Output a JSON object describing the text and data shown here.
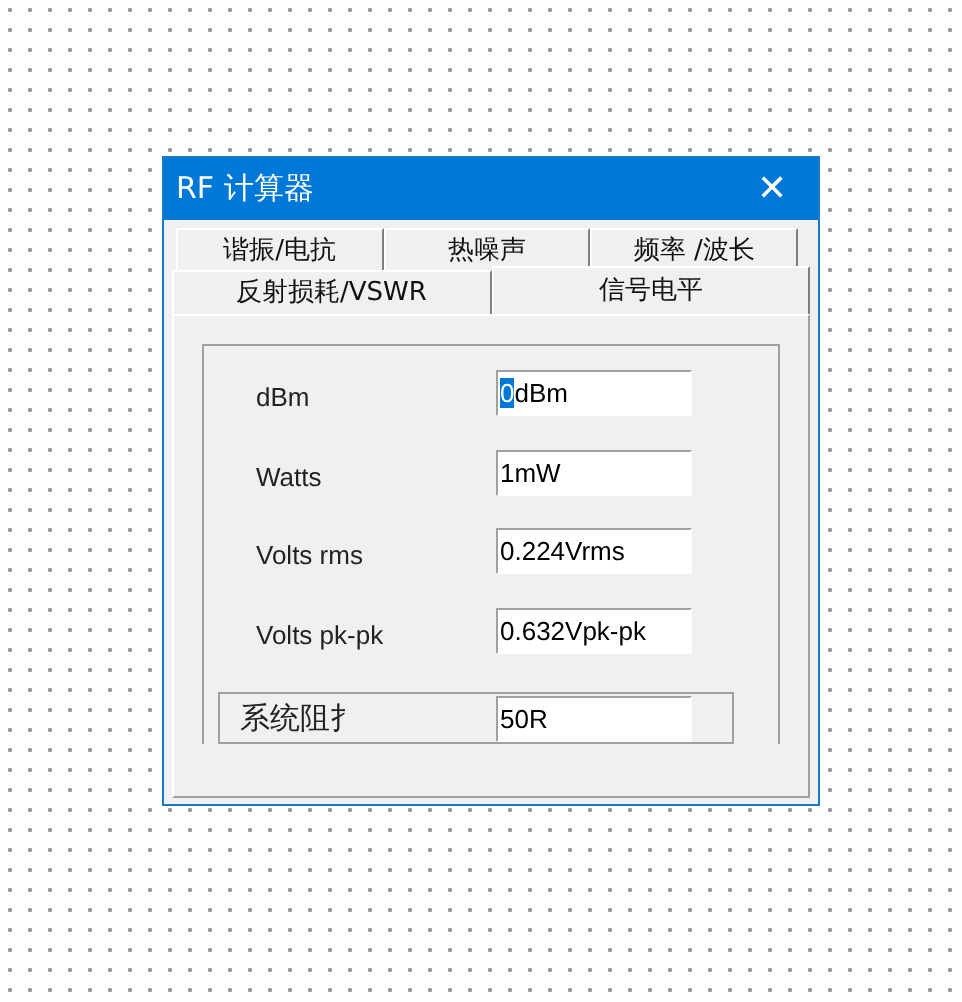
{
  "window": {
    "title": "RF 计算器",
    "close": "✕"
  },
  "tab_rows": [
    [
      {
        "label": "谐振/电抗",
        "selected": false
      },
      {
        "label": "热噪声",
        "selected": false
      },
      {
        "label": "频率 /波长",
        "selected": false
      }
    ],
    [
      {
        "label": "反射损耗/VSWR",
        "selected": false
      },
      {
        "label": "信号电平",
        "selected": true
      }
    ]
  ],
  "fields": [
    {
      "label": "dBm",
      "value": "0dBm",
      "focused": true
    },
    {
      "label": "Watts",
      "value": "1mW",
      "focused": false
    },
    {
      "label": "Volts rms",
      "value": "0.224Vrms",
      "focused": false
    },
    {
      "label": "Volts pk-pk",
      "value": "0.632Vpk-pk",
      "focused": false
    }
  ],
  "impedance": {
    "label": "系统阻扌",
    "value": "50R"
  }
}
